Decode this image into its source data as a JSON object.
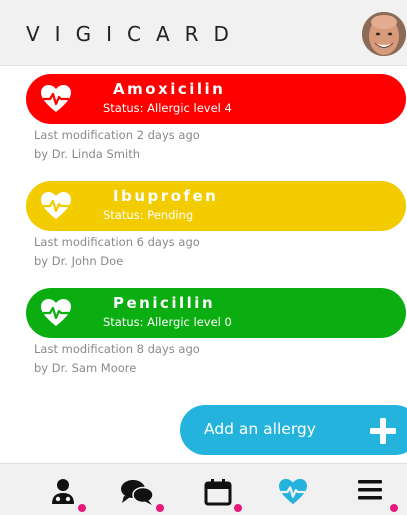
{
  "app": {
    "title": "VIGICARD"
  },
  "allergies": [
    {
      "name": "Amoxicilin",
      "status": "Status: Allergic level 4",
      "modified": "Last modification 2 days ago",
      "by": "by Dr. Linda Smith",
      "color": "#fe0000"
    },
    {
      "name": "Ibuprofen",
      "status": "Status: Pending",
      "modified": "Last modification 6 days ago",
      "by": "by Dr. John Doe",
      "color": "#f3cc00"
    },
    {
      "name": "Penicillin",
      "status": "Status: Allergic level 0",
      "modified": "Last modification 8 days ago",
      "by": "by Dr. Sam Moore",
      "color": "#0aae10"
    }
  ],
  "actions": {
    "add_label": "Add an allergy",
    "accent": "#23b3dc"
  },
  "bottom_nav": {
    "items": [
      {
        "icon": "doctor-icon",
        "notification": true
      },
      {
        "icon": "chat-icon",
        "notification": true
      },
      {
        "icon": "calendar-icon",
        "notification": true
      },
      {
        "icon": "heartbeat-icon",
        "notification": false,
        "active": true
      },
      {
        "icon": "menu-icon",
        "notification": true
      }
    ],
    "notification_color": "#e8197a",
    "active_color": "#23b3dc"
  }
}
